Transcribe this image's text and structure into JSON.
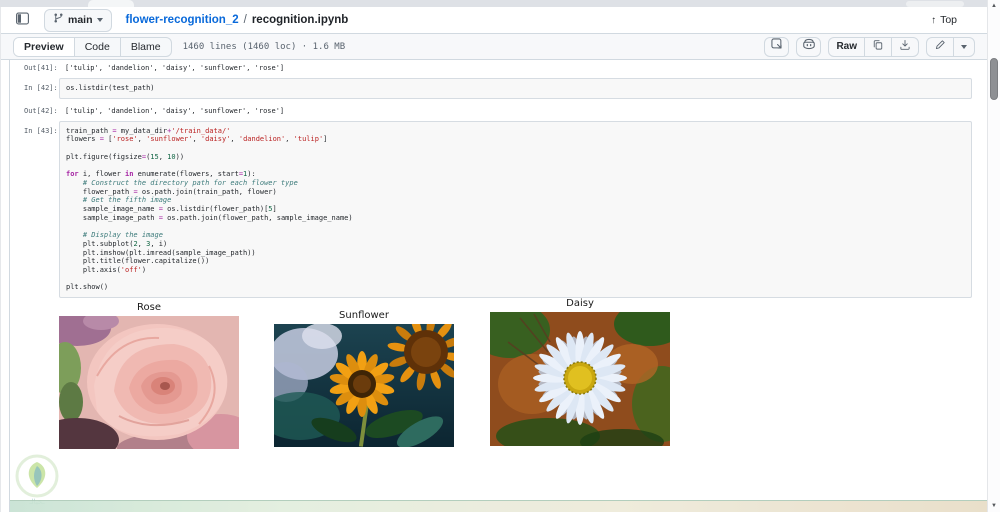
{
  "header": {
    "branch_label": "main",
    "breadcrumb": {
      "repo_link": "flower-recognition_2",
      "separator": "/",
      "file_name": "recognition.ipynb"
    },
    "top_link": "Top",
    "top_arrow": "↑",
    "icons": {
      "sidebar_toggle": "panel-icon",
      "branch": "git-branch-icon",
      "caret": "chevron-down-icon"
    }
  },
  "toolbar": {
    "tabs": [
      {
        "label": "Preview",
        "active": true
      },
      {
        "label": "Code",
        "active": false
      },
      {
        "label": "Blame",
        "active": false
      }
    ],
    "meta": "1460 lines (1460 loc) · 1.6 MB",
    "raw_label": "Raw",
    "icons": {
      "symbols": "symbols-panel-icon",
      "copilot": "copilot-icon",
      "copy": "copy-icon",
      "download": "download-icon",
      "edit": "pencil-icon",
      "more": "chevron-down-icon"
    }
  },
  "notebook": {
    "cells": [
      {
        "type": "output",
        "prompt": "Out[41]:",
        "text": "['tulip', 'dandelion', 'daisy', 'sunflower', 'rose']"
      },
      {
        "type": "input",
        "prompt": "In [42]:",
        "lines": [
          [
            [
              "p",
              "os.listdir(test_path)"
            ]
          ]
        ]
      },
      {
        "type": "output",
        "prompt": "Out[42]:",
        "text": "['tulip', 'dandelion', 'daisy', 'sunflower', 'rose']"
      },
      {
        "type": "input",
        "prompt": "In [43]:",
        "lines": [
          [
            [
              "p",
              "train_path "
            ],
            [
              "o",
              "="
            ],
            [
              "p",
              " my_data_dir"
            ],
            [
              "o",
              "+"
            ],
            [
              "s",
              "'/train_data/'"
            ]
          ],
          [
            [
              "p",
              "flowers "
            ],
            [
              "o",
              "="
            ],
            [
              "p",
              " ["
            ],
            [
              "s",
              "'rose'"
            ],
            [
              "p",
              ", "
            ],
            [
              "s",
              "'sunflower'"
            ],
            [
              "p",
              ", "
            ],
            [
              "s",
              "'daisy'"
            ],
            [
              "p",
              ", "
            ],
            [
              "s",
              "'dandelion'"
            ],
            [
              "p",
              ", "
            ],
            [
              "s",
              "'tulip'"
            ],
            [
              "p",
              "]"
            ]
          ],
          [],
          [
            [
              "p",
              "plt.figure(figsize"
            ],
            [
              "o",
              "="
            ],
            [
              "p",
              "("
            ],
            [
              "n",
              "15"
            ],
            [
              "p",
              ", "
            ],
            [
              "n",
              "10"
            ],
            [
              "p",
              "))"
            ]
          ],
          [],
          [
            [
              "k",
              "for"
            ],
            [
              "p",
              " i, flower "
            ],
            [
              "k",
              "in"
            ],
            [
              "p",
              " enumerate(flowers, start"
            ],
            [
              "o",
              "="
            ],
            [
              "n",
              "1"
            ],
            [
              "p",
              "):"
            ]
          ],
          [
            [
              "c",
              "    # Construct the directory path for each flower type"
            ]
          ],
          [
            [
              "p",
              "    flower_path "
            ],
            [
              "o",
              "="
            ],
            [
              "p",
              " os.path.join(train_path, flower)"
            ]
          ],
          [
            [
              "c",
              "    # Get the fifth image"
            ]
          ],
          [
            [
              "p",
              "    sample_image_name "
            ],
            [
              "o",
              "="
            ],
            [
              "p",
              " os.listdir(flower_path)["
            ],
            [
              "n",
              "5"
            ],
            [
              "p",
              "]"
            ]
          ],
          [
            [
              "p",
              "    sample_image_path "
            ],
            [
              "o",
              "="
            ],
            [
              "p",
              " os.path.join(flower_path, sample_image_name)"
            ]
          ],
          [],
          [
            [
              "c",
              "    # Display the image"
            ]
          ],
          [
            [
              "p",
              "    plt.subplot("
            ],
            [
              "n",
              "2"
            ],
            [
              "p",
              ", "
            ],
            [
              "n",
              "3"
            ],
            [
              "p",
              ", i)"
            ]
          ],
          [
            [
              "p",
              "    plt.imshow(plt.imread(sample_image_path))"
            ]
          ],
          [
            [
              "p",
              "    plt.title(flower.capitalize())"
            ]
          ],
          [
            [
              "p",
              "    plt.axis("
            ],
            [
              "s",
              "'off'"
            ],
            [
              "p",
              ")"
            ]
          ],
          [],
          [
            [
              "p",
              "plt.show()"
            ]
          ]
        ]
      }
    ],
    "figure": {
      "titles": [
        "Rose",
        "Sunflower",
        "Daisy"
      ]
    }
  },
  "colors": {
    "accent_link": "#0969da",
    "border": "#d1d9e0",
    "keyword": "#a626a4",
    "operator": "#a626a4",
    "string": "#ba2121",
    "number": "#116644",
    "comment": "#3d7b7b",
    "code_text": "#1f2328"
  }
}
